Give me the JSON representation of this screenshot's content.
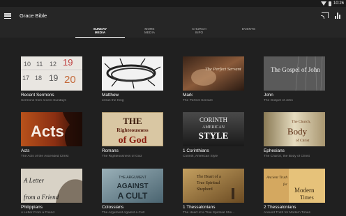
{
  "status": {
    "time": "10:26"
  },
  "app": {
    "title": "Grace Bible"
  },
  "tabs": [
    {
      "line1": "Sunday",
      "line2": "Media",
      "active": true
    },
    {
      "line1": "More",
      "line2": "Media",
      "active": false
    },
    {
      "line1": "Church",
      "line2": "Info",
      "active": false
    },
    {
      "line1": "Events",
      "line2": "",
      "active": false
    }
  ],
  "cards": [
    {
      "title": "Recent Sermons",
      "subtitle": "Sermons from recent Sundays",
      "art": "calendar",
      "art_text": ""
    },
    {
      "title": "Matthew",
      "subtitle": "Jesus the King",
      "art": "thorns",
      "art_text": ""
    },
    {
      "title": "Mark",
      "subtitle": "The Perfect Servant",
      "art": "mark",
      "art_text": "The Perfect Servant"
    },
    {
      "title": "John",
      "subtitle": "The Gospel of John",
      "art": "john",
      "art_text": "The Gospel of John"
    },
    {
      "title": "Acts",
      "subtitle": "The Acts of the Ascended Christ",
      "art": "acts",
      "art_text": "Acts"
    },
    {
      "title": "Romans",
      "subtitle": "The Righteousness of God",
      "art": "romans",
      "art_text": "The Righteousness of God"
    },
    {
      "title": "1 Corinthians",
      "subtitle": "Corinth, American Style",
      "art": "corinth",
      "art_text": "CORINTH AMERICAN STYLE"
    },
    {
      "title": "Ephesians",
      "subtitle": "The Church, the Body of Christ",
      "art": "ephesians",
      "art_text": "The Church, the Body of Christ"
    },
    {
      "title": "Philippians",
      "subtitle": "A Letter From a Friend",
      "art": "philippians",
      "art_text": "A Letter from a Friend"
    },
    {
      "title": "Colossians",
      "subtitle": "The Argument Against a Cult",
      "art": "colossians",
      "art_text": "THE ARGUMENT AGAINST A CULT"
    },
    {
      "title": "1 Thessalonians",
      "subtitle": "The Heart of a True Spiritual She...",
      "art": "thess1",
      "art_text": "The Heart of a True Spiritual Shepherd"
    },
    {
      "title": "2 Thessalonians",
      "subtitle": "Ancient Truth for Modern Times",
      "art": "thess2",
      "art_text": "Ancient Truth for Modern Times"
    }
  ],
  "colors": {
    "background": "#202020",
    "app_bar": "#262626",
    "subtitle_text": "#8c8c8c"
  }
}
